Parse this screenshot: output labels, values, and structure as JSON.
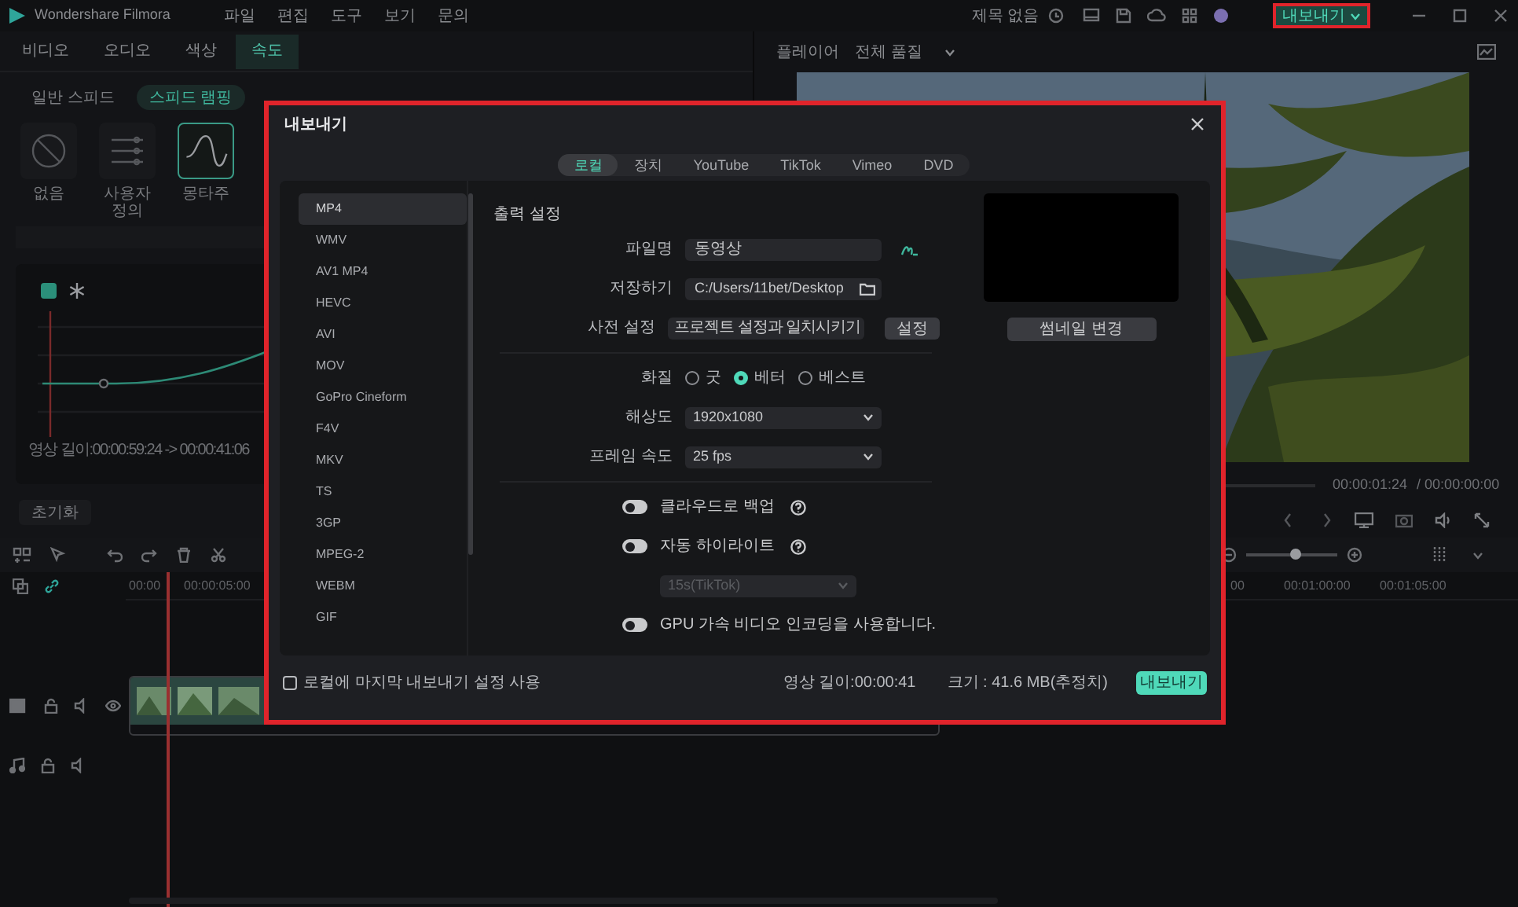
{
  "title_bar": {
    "app_name": "Wondershare Filmora",
    "menus": [
      "파일",
      "편집",
      "도구",
      "보기",
      "문의"
    ],
    "project_title": "제목 없음",
    "export_button": "내보내기"
  },
  "left_panel": {
    "tabs": [
      {
        "label": "비디오",
        "selected": false
      },
      {
        "label": "오디오",
        "selected": false
      },
      {
        "label": "색상",
        "selected": false
      },
      {
        "label": "속도",
        "selected": true
      }
    ],
    "sub_tabs": [
      {
        "label": "일반 스피드",
        "selected": false
      },
      {
        "label": "스피드 램핑",
        "selected": true
      }
    ],
    "presets": [
      {
        "label": "없음",
        "selected": false
      },
      {
        "label": "사용자 정의",
        "selected": false
      },
      {
        "label": "몽타주",
        "selected": true
      }
    ],
    "duration": "영상 길이:00:00:59:24 -> 00:00:41:06",
    "reset_button": "초기화"
  },
  "preview": {
    "tab": "플레이어",
    "quality": "전체 품질",
    "current_time": "00:00:01:24",
    "total_time": "/ 00:00:00:00"
  },
  "timeline": {
    "ruler": [
      "00:00",
      "00:00:05:00",
      "00",
      "00:01:00:00",
      "00:01:05:00"
    ],
    "zoom": {
      "level": 0.55
    }
  },
  "export_dialog": {
    "title": "내보내기",
    "tabs": [
      {
        "label": "로컬",
        "selected": true
      },
      {
        "label": "장치",
        "selected": false
      },
      {
        "label": "YouTube",
        "selected": false
      },
      {
        "label": "TikTok",
        "selected": false
      },
      {
        "label": "Vimeo",
        "selected": false
      },
      {
        "label": "DVD",
        "selected": false
      }
    ],
    "formats": [
      {
        "label": "MP4",
        "selected": true
      },
      {
        "label": "WMV",
        "selected": false
      },
      {
        "label": "AV1 MP4",
        "selected": false
      },
      {
        "label": "HEVC",
        "selected": false
      },
      {
        "label": "AVI",
        "selected": false
      },
      {
        "label": "MOV",
        "selected": false
      },
      {
        "label": "GoPro Cineform",
        "selected": false
      },
      {
        "label": "F4V",
        "selected": false
      },
      {
        "label": "MKV",
        "selected": false
      },
      {
        "label": "TS",
        "selected": false
      },
      {
        "label": "3GP",
        "selected": false
      },
      {
        "label": "MPEG-2",
        "selected": false
      },
      {
        "label": "WEBM",
        "selected": false
      },
      {
        "label": "GIF",
        "selected": false
      }
    ],
    "section_title": "출력 설정",
    "file_name": {
      "label": "파일명",
      "value": "동영상"
    },
    "save_to": {
      "label": "저장하기",
      "value": "C:/Users/11bet/Desktop"
    },
    "preset": {
      "label": "사전 설정",
      "value": "프로젝트 설정과 일치시키기",
      "button": "설정"
    },
    "quality": {
      "label": "화질",
      "options": [
        {
          "label": "굿",
          "selected": false
        },
        {
          "label": "베터",
          "selected": true
        },
        {
          "label": "베스트",
          "selected": false
        }
      ]
    },
    "resolution": {
      "label": "해상도",
      "value": "1920x1080"
    },
    "frame_rate": {
      "label": "프레임 속도",
      "value": "25 fps"
    },
    "options": [
      {
        "kind": "toggle",
        "label": "클라우드로 백업",
        "on": false,
        "help": true
      },
      {
        "kind": "toggle",
        "label": "자동 하이라이트",
        "on": false,
        "help": true
      },
      {
        "kind": "dropdown",
        "value": "15s(TikTok)",
        "disabled": true
      },
      {
        "kind": "toggle",
        "label": "GPU 가속 비디오 인코딩을 사용합니다.",
        "on": false,
        "help": false
      }
    ],
    "thumbnail_button": "썸네일 변경",
    "remember": {
      "label": "로컬에 마지막 내보내기 설정 사용",
      "checked": false
    },
    "duration": "영상 길이:00:00:41",
    "size": "크기 : 41.6 MB(추정치)",
    "export_button": "내보내기"
  }
}
